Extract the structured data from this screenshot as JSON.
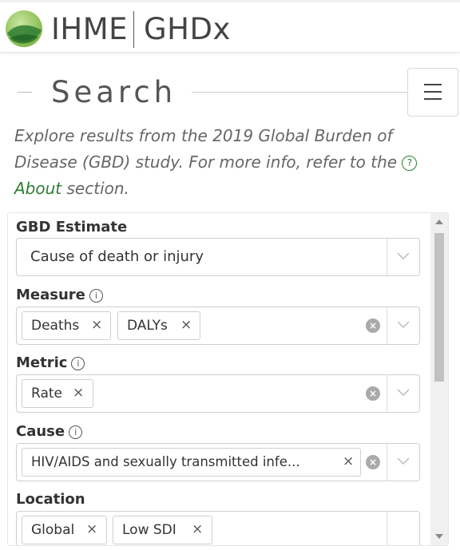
{
  "header": {
    "logo_primary": "IHME",
    "logo_secondary": "GHDx"
  },
  "page": {
    "title": "Search",
    "description": "Explore results from the 2019 Global Burden of Disease (GBD) study. For more info, refer to the",
    "about_link": "About",
    "description_tail": "section."
  },
  "form": {
    "gbd_estimate": {
      "label": "GBD Estimate",
      "value": "Cause of death or injury"
    },
    "measure": {
      "label": "Measure",
      "chips": [
        "Deaths",
        "DALYs"
      ]
    },
    "metric": {
      "label": "Metric",
      "chips": [
        "Rate"
      ]
    },
    "cause": {
      "label": "Cause",
      "chips": [
        "HIV/AIDS and sexually transmitted infe..."
      ]
    },
    "location": {
      "label": "Location",
      "chips": [
        "Global",
        "Low SDI"
      ]
    }
  },
  "icons": {
    "remove_glyph": "×",
    "clear_glyph": "×",
    "info_glyph": "i",
    "help_glyph": "?"
  },
  "colors": {
    "link_green": "#2e7d32",
    "text_dark": "#333333"
  }
}
